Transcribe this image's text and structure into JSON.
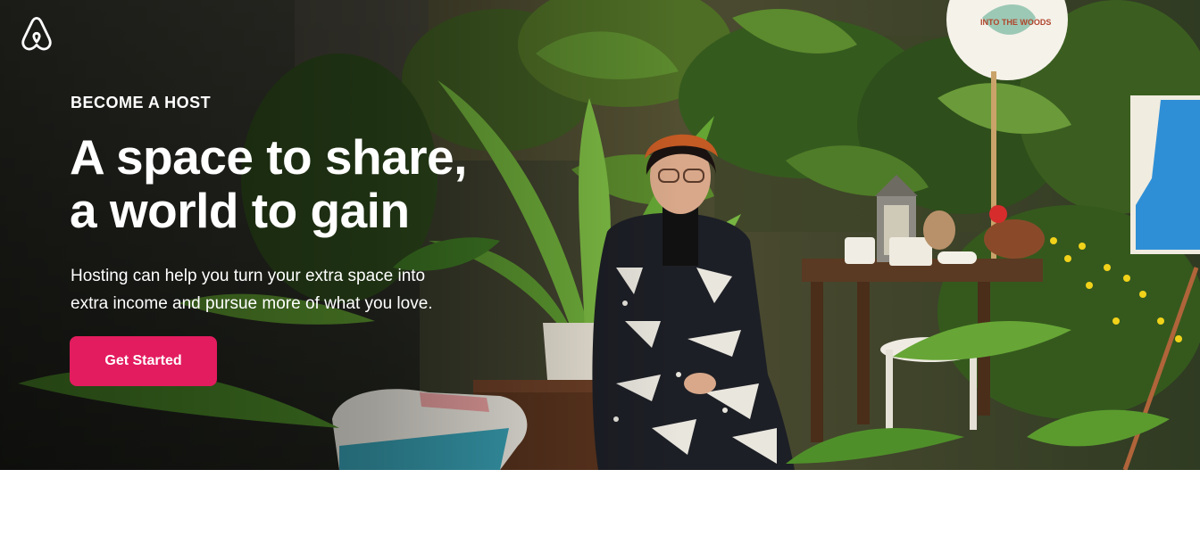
{
  "brand": {
    "logo_icon": "airbnb-logo-icon",
    "accent_color": "#e31c5f"
  },
  "hero": {
    "eyebrow": "BECOME A HOST",
    "headline_line1": "A space to share,",
    "headline_line2": "a world to gain",
    "subtext_line1": "Hosting can help you turn your extra space into",
    "subtext_line2": "extra income and pursue more of what you love.",
    "cta_label": "Get Started",
    "sign_text": "INTO THE WOODS"
  }
}
